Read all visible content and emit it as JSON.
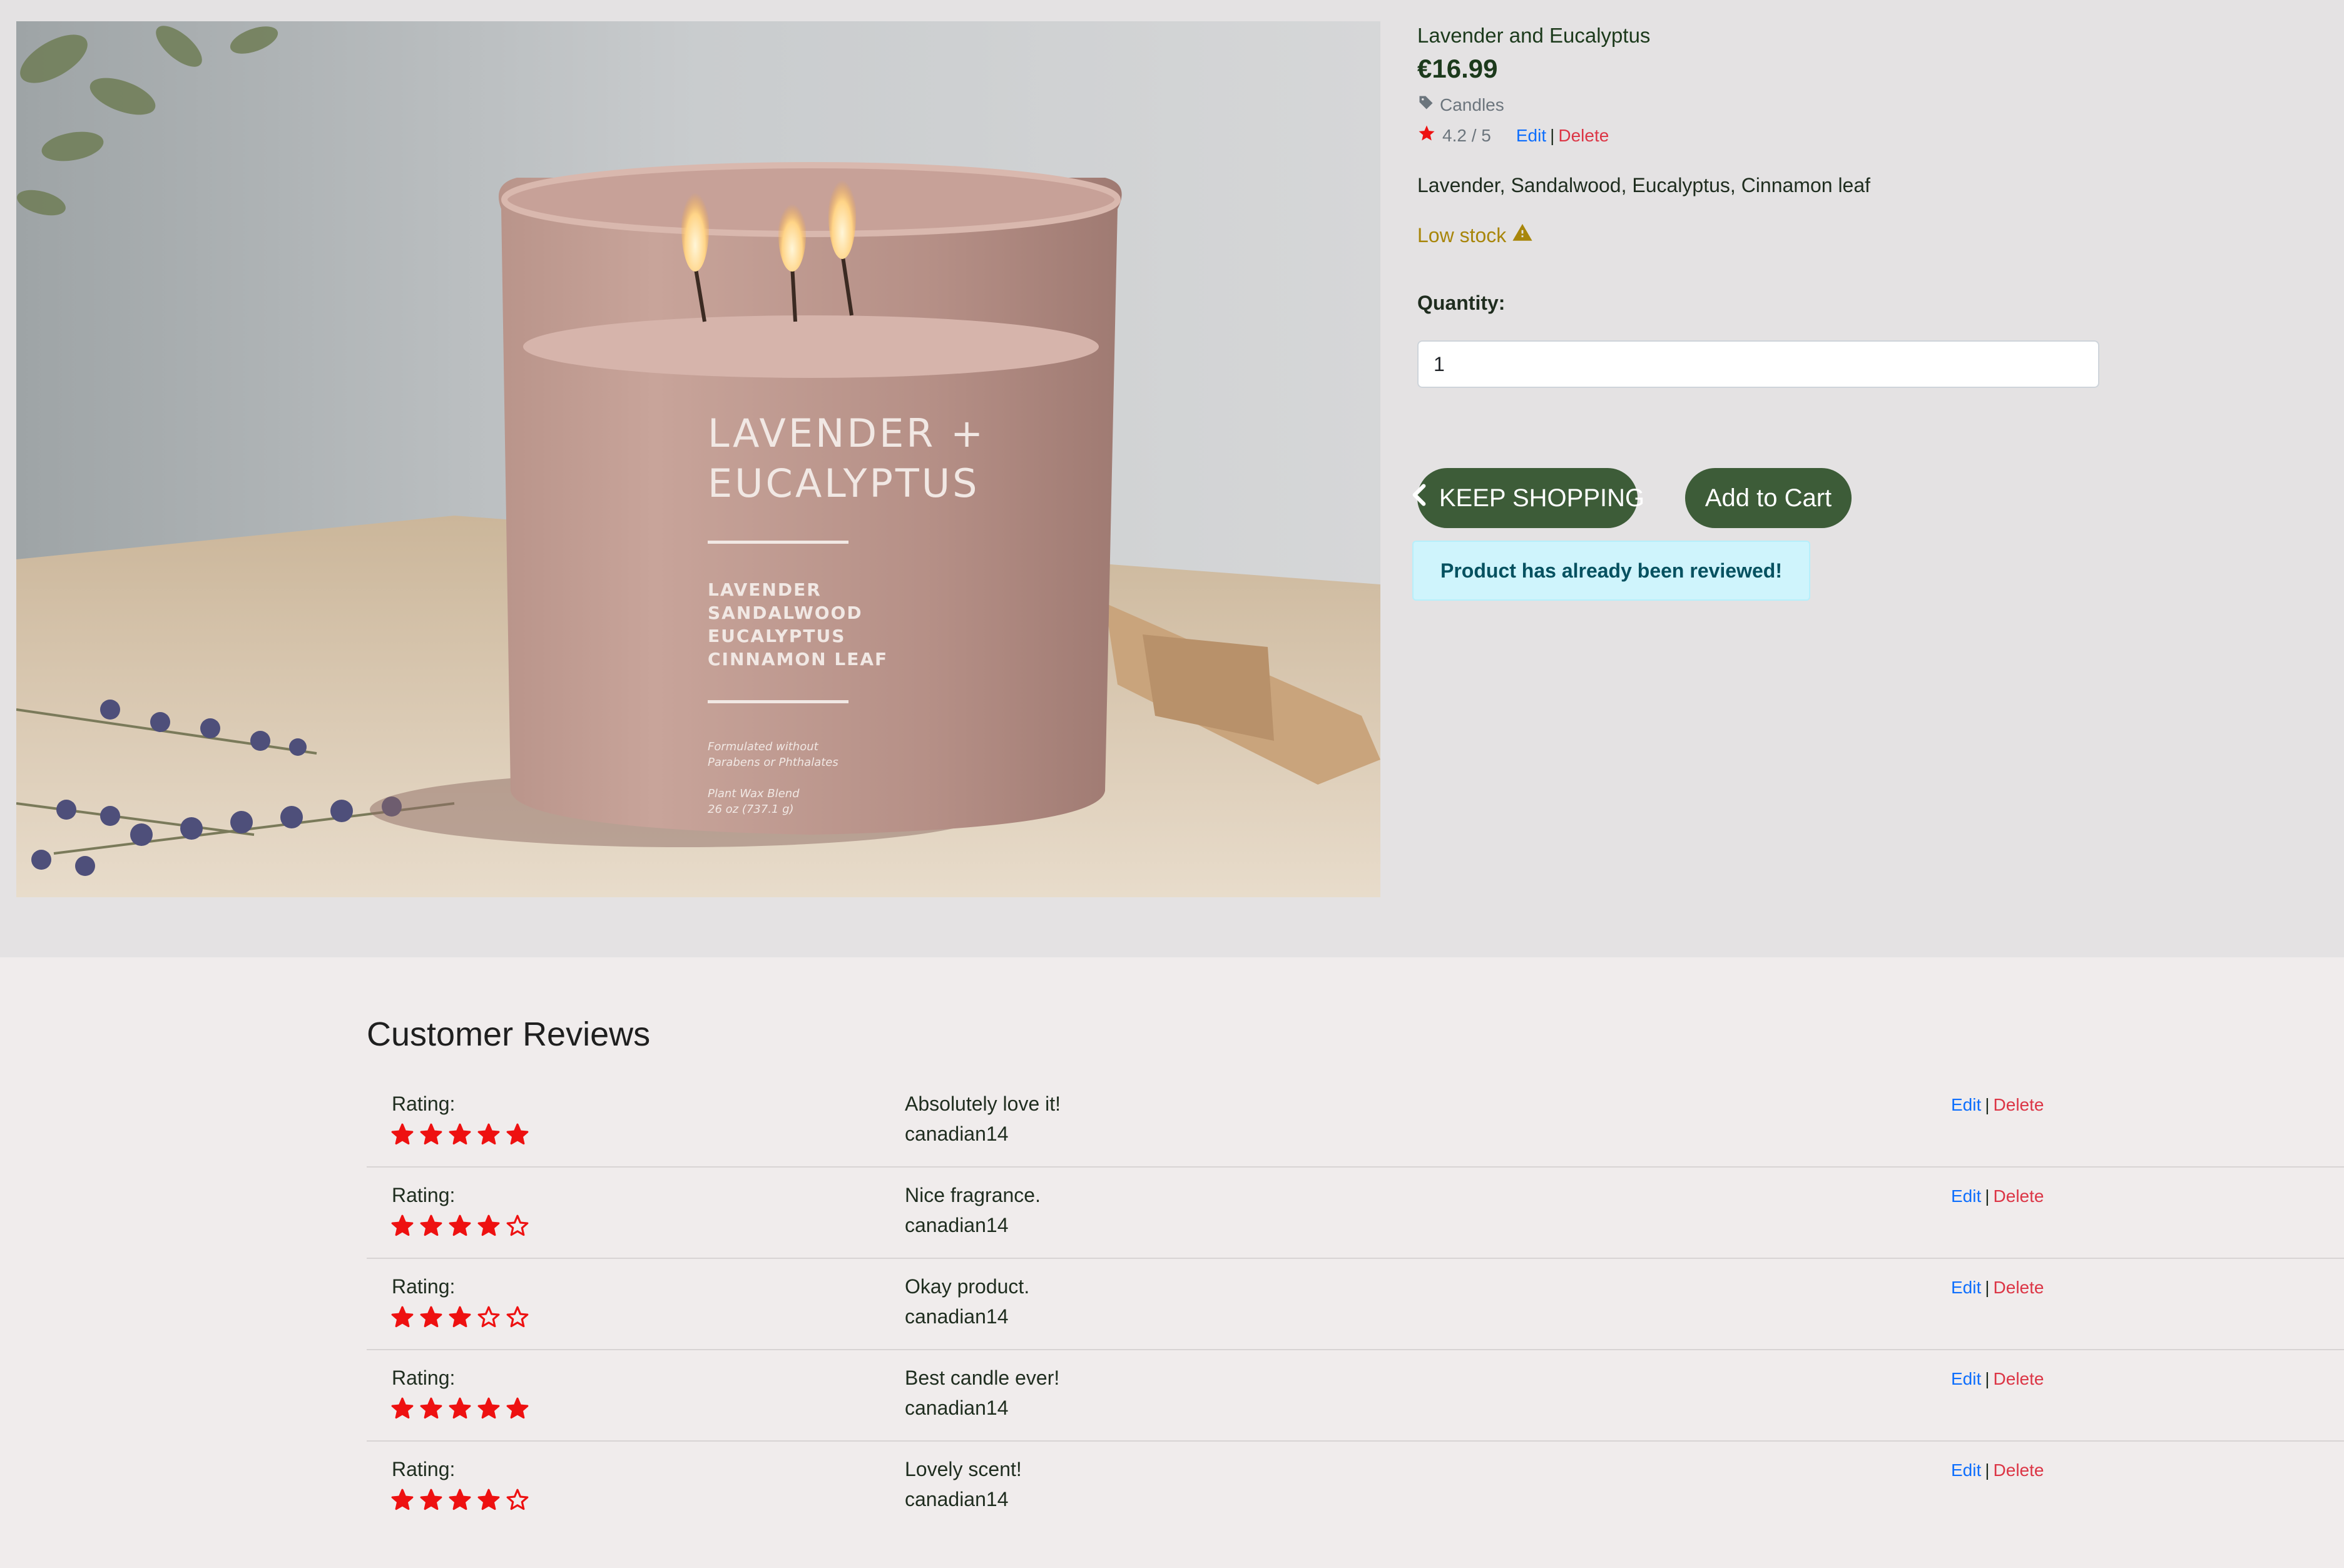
{
  "product": {
    "name": "Lavender and Eucalyptus",
    "price": "€16.99",
    "category": "Candles",
    "rating": "4.2 / 5",
    "edit_label": "Edit",
    "delete_label": "Delete",
    "ingredients": "Lavender, Sandalwood, Eucalyptus, Cinnamon leaf",
    "stock_status": "Low stock",
    "quantity_label": "Quantity:",
    "quantity_value": "1",
    "keep_shopping_label": "KEEP SHOPPING",
    "add_to_cart_label": "Add to Cart",
    "alert_message": "Product has already been reviewed!"
  },
  "product_image": {
    "title_line1": "LAVENDER +",
    "title_line2": "EUCALYPTUS",
    "notes": [
      "LAVENDER",
      "SANDALWOOD",
      "EUCALYPTUS",
      "CINNAMON LEAF"
    ],
    "fine_print_1": "Formulated without",
    "fine_print_2": "Parabens or Phthalates",
    "fine_print_3": "Plant Wax Blend",
    "fine_print_4": "26 oz (737.1 g)"
  },
  "reviews": {
    "title": "Customer Reviews",
    "rating_label": "Rating:",
    "edit_label": "Edit",
    "delete_label": "Delete",
    "items": [
      {
        "rating": 5,
        "text": "Absolutely love it!",
        "user": "canadian14"
      },
      {
        "rating": 4,
        "text": "Nice fragrance.",
        "user": "canadian14"
      },
      {
        "rating": 3,
        "text": "Okay product.",
        "user": "canadian14"
      },
      {
        "rating": 5,
        "text": "Best candle ever!",
        "user": "canadian14"
      },
      {
        "rating": 4,
        "text": "Lovely scent!",
        "user": "canadian14"
      }
    ]
  },
  "colors": {
    "primary_button": "#3d5c38",
    "star": "#ee1111",
    "edit_link": "#0d6efd",
    "delete_link": "#dc3545",
    "low_stock": "#a8860b",
    "alert_bg": "#cff4fc"
  }
}
